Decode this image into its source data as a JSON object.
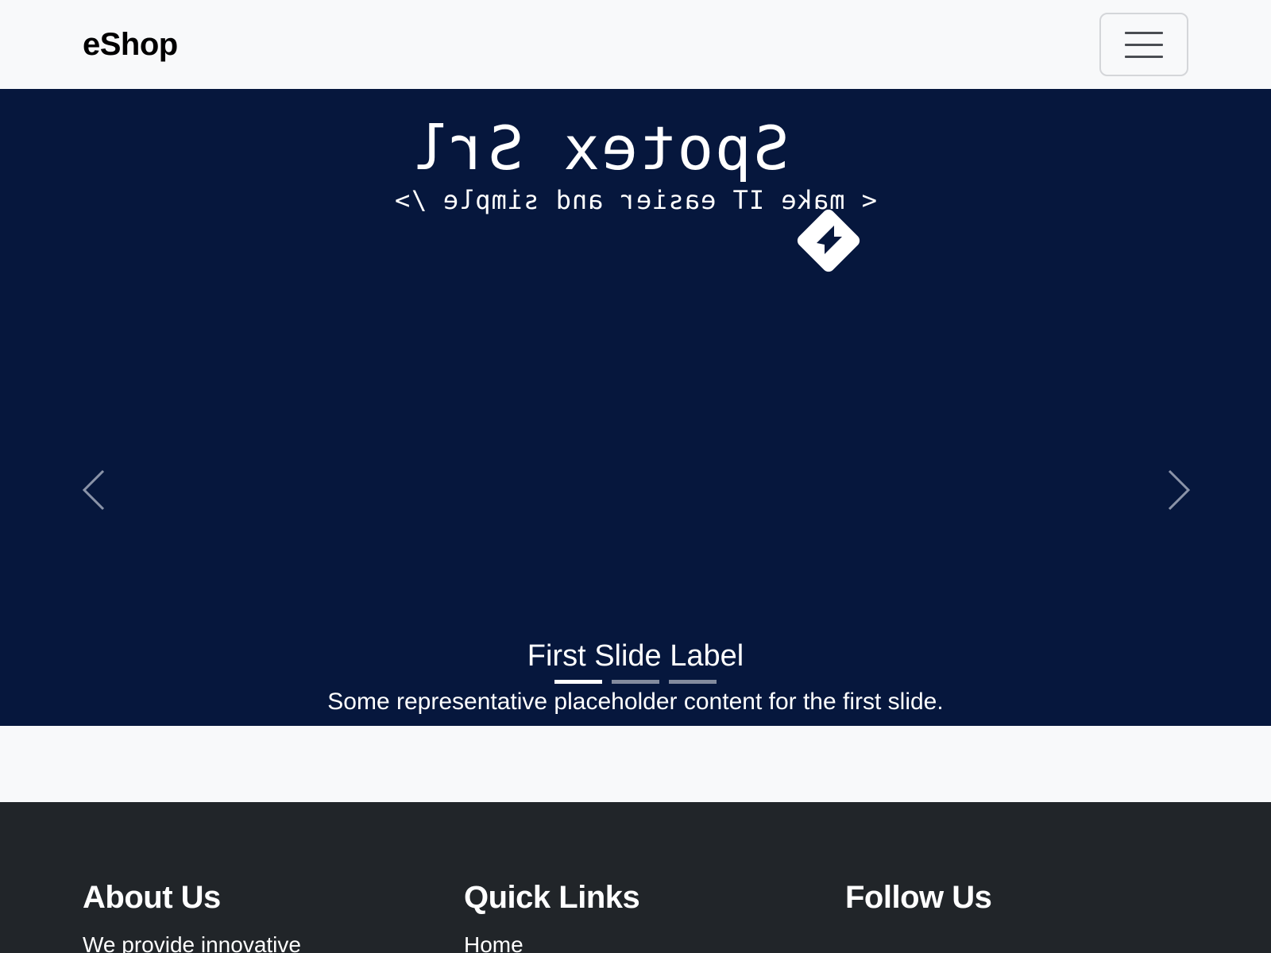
{
  "navbar": {
    "brand": "eShop",
    "toggler_icon": "hamburger-icon"
  },
  "carousel": {
    "logo": {
      "title": "Spotex Srl",
      "tagline": "< make IT easier and simple />",
      "icon": "spotex-diamond-logo-icon"
    },
    "prev_icon": "chevron-left-icon",
    "next_icon": "chevron-right-icon",
    "active_slide": 1,
    "slide_count": 3,
    "caption": {
      "title": "First Slide Label",
      "text": "Some representative placeholder content for the first slide."
    },
    "colors": {
      "background": "#06173d",
      "text": "#ffffff"
    }
  },
  "footer": {
    "columns": [
      {
        "title": "About Us",
        "text": "We provide innovative"
      },
      {
        "title": "Quick Links",
        "text": "Home"
      },
      {
        "title": "Follow Us",
        "text": ""
      }
    ],
    "colors": {
      "background": "#212529"
    }
  }
}
